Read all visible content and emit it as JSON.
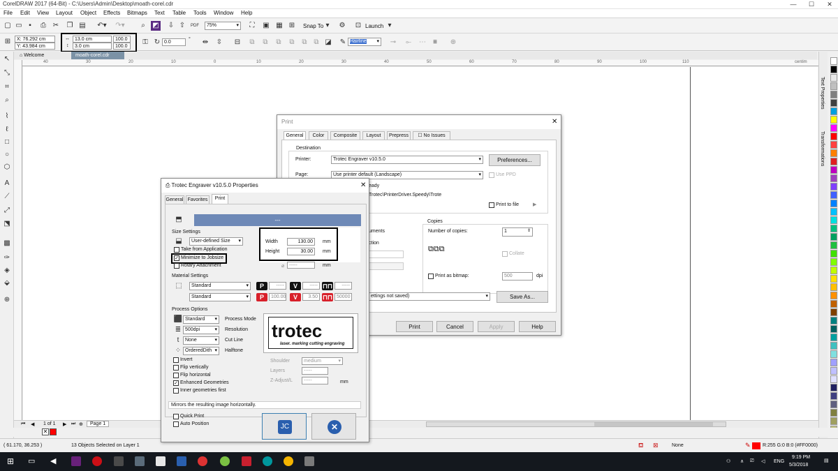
{
  "window": {
    "title": "CorelDRAW 2017 (64-Bit) - C:\\Users\\Admin\\Desktop\\moath-corel.cdr",
    "minimize": "—",
    "maximize": "☐",
    "close": "✕"
  },
  "menu": [
    "File",
    "Edit",
    "View",
    "Layout",
    "Object",
    "Effects",
    "Bitmaps",
    "Text",
    "Table",
    "Tools",
    "Window",
    "Help"
  ],
  "toolbar": {
    "zoom": "75%",
    "snap_to": "Snap To",
    "launch": "Launch"
  },
  "propbar": {
    "x": "X: 76.292 cm",
    "y": "Y: 43.984 cm",
    "width": "13.0 cm",
    "height": "3.0 cm",
    "scale_w": "100.0",
    "scale_h": "100.0",
    "rotation": "0.0",
    "deg": "°",
    "outline": "Hairline"
  },
  "doc_tabs": [
    "Welcome Screen",
    "moath-corel.cdr"
  ],
  "ruler_labels": [
    "40",
    "30",
    "20",
    "10",
    "0",
    "10",
    "20",
    "30",
    "40",
    "50",
    "60",
    "70",
    "80",
    "90",
    "100",
    "110"
  ],
  "ruler_unit": "centim",
  "right_dock": [
    "Text Properties",
    "Transformations"
  ],
  "page_nav": {
    "label": "1 of 1",
    "page": "Page 1"
  },
  "status": {
    "coords": "( 61.170, 36.253 )",
    "selection": "13 Objects Selected on Layer 1",
    "fill": "None",
    "outline_color": "R:255 G:0 B:0 (#FF0000)"
  },
  "taskbar": {
    "time": "9:19 PM",
    "date": "5/3/2018",
    "lang": "ENG"
  },
  "palette_colors": [
    "#ffffff",
    "#000000",
    "#e8e8e8",
    "#c0c0c0",
    "#808080",
    "#404040",
    "#00a0e0",
    "#ffff00",
    "#ff00ff",
    "#ff0000",
    "#ff4040",
    "#ff8000",
    "#e02020",
    "#c000c0",
    "#a040c0",
    "#8040ff",
    "#4060ff",
    "#0080ff",
    "#00c0ff",
    "#00e0e0",
    "#00c080",
    "#00a060",
    "#20c040",
    "#40e000",
    "#80ff00",
    "#c0ff00",
    "#ffe000",
    "#ffc000",
    "#ff9000",
    "#c06000",
    "#804000",
    "#008080",
    "#006060",
    "#00a0a0",
    "#40c0c0",
    "#80e0e0",
    "#a0a0ff",
    "#c0c0ff",
    "#e0e0ff",
    "#202060",
    "#404080",
    "#606080",
    "#808040",
    "#a0a060",
    "#c0c080"
  ],
  "print_dialog": {
    "title": "Print",
    "tabs": [
      "General",
      "Color",
      "Composite",
      "Layout",
      "Prepress",
      "No Issues"
    ],
    "destination": "Destination",
    "printer_label": "Printer:",
    "printer": "Trotec Engraver v10.5.0",
    "preferences": "Preferences...",
    "page_label": "Page:",
    "page": "Use printer default (Landscape)",
    "use_ppd": "Use PPD",
    "status_text": "eady",
    "path_text": "Trotec\\PrinterDriver.Speedy\\Trote",
    "print_to_file": "Print to file",
    "documents": "uments",
    "selection": "ction",
    "copies_title": "Copies",
    "num_copies_label": "Number of copies:",
    "num_copies": "1",
    "collate": "Collate",
    "print_as_bitmap": "Print as bitmap:",
    "bitmap_dpi": "500",
    "dpi": "dpi",
    "style": "ettings not saved)",
    "save_as": "Save As...",
    "print": "Print",
    "cancel": "Cancel",
    "apply": "Apply",
    "help": "Help"
  },
  "trotec_dialog": {
    "title": "Trotec Engraver v10.5.0 Properties",
    "tabs": [
      "General",
      "Favorites",
      "Print"
    ],
    "banner": "---",
    "size_settings": "Size Settings",
    "size_type": "User-defined Size",
    "take_from_app": "Take from Application",
    "minimize_to_jobsize": "Minimize to Jobsize",
    "rotary": "Rotary Attachment",
    "width_label": "Width",
    "width": "130.00",
    "height_label": "Height",
    "height": "30.00",
    "unit": "mm",
    "rot_value": "-----",
    "material_settings": "Material Settings",
    "material1": "Standard",
    "material2": "Standard",
    "p_label": "P",
    "v_label": "V",
    "p1": "-----",
    "v1": "-----",
    "w1": "-----",
    "p2": "100.00",
    "v2": "3.50",
    "w2": "50000",
    "process_options": "Process Options",
    "process_mode_val": "Standard",
    "process_mode": "Process Mode",
    "resolution_val": "500dpi",
    "resolution": "Resolution",
    "cutline_val": "None",
    "cutline": "Cut Line",
    "halftone_val": "OrderedDith",
    "halftone": "Halftone",
    "invert": "Invert",
    "flip_v": "Flip vertically",
    "flip_h": "Flip horizontal",
    "enhanced": "Enhanced Geometries",
    "inner_first": "Inner geometries first",
    "logo_text": "trotec",
    "logo_tagline": "laser. marking cutting engraving",
    "shoulder_label": "Shoulder",
    "shoulder": "medium",
    "layers_label": "Layers",
    "layers": "-----",
    "zadjust_label": "Z-Adjust/L",
    "zadjust": "-----",
    "zadjust_unit": "mm",
    "hint": "Mirrors the resulting image horizontally.",
    "quick_print": "Quick Print",
    "auto_position": "Auto Position"
  }
}
